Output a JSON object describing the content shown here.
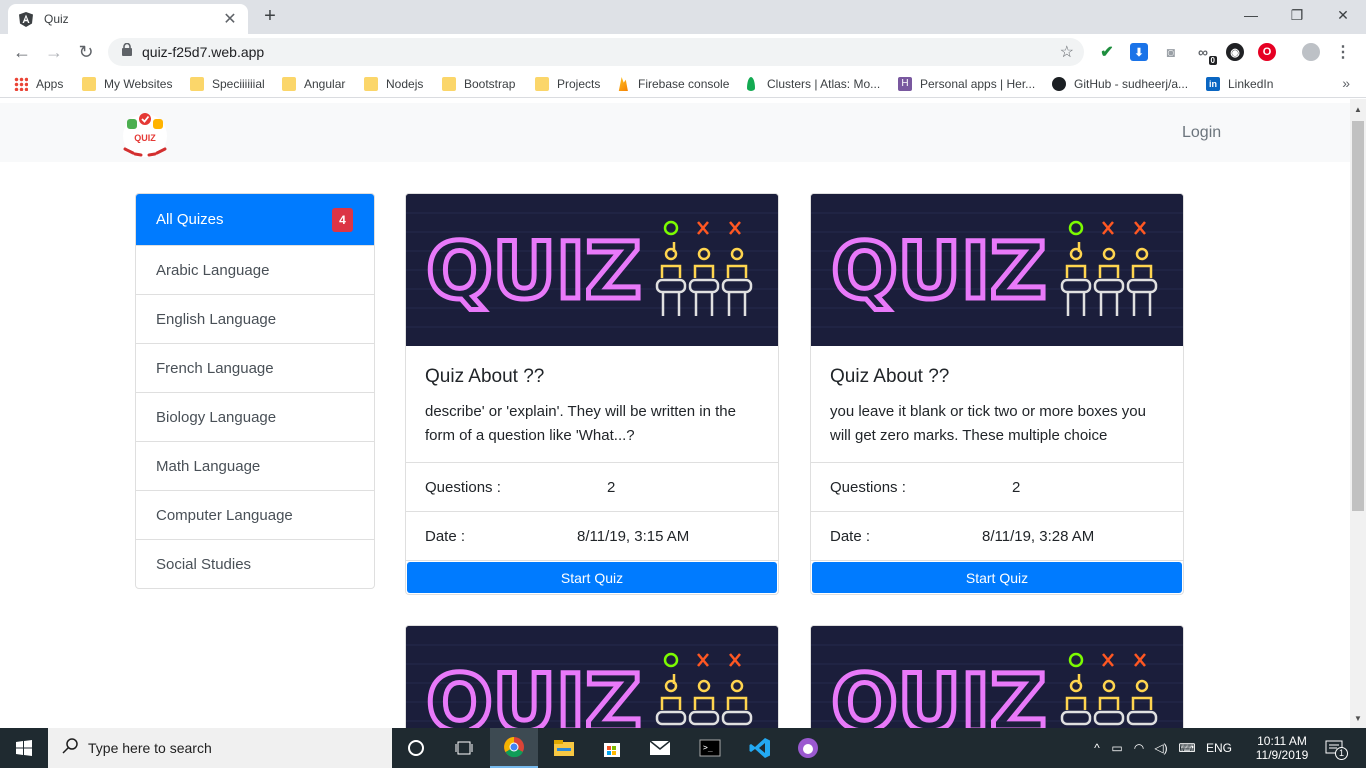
{
  "browser": {
    "tab_title": "Quiz",
    "url": "quiz-f25d7.web.app",
    "ext_badge": "0",
    "bookmarks": [
      {
        "label": "Apps",
        "icon": "apps-grid-icon"
      },
      {
        "label": "My Websites",
        "icon": "folder-icon"
      },
      {
        "label": "Speciiiiiial",
        "icon": "folder-icon"
      },
      {
        "label": "Angular",
        "icon": "folder-icon"
      },
      {
        "label": "Nodejs",
        "icon": "folder-icon"
      },
      {
        "label": "Bootstrap",
        "icon": "folder-icon"
      },
      {
        "label": "Projects",
        "icon": "folder-icon"
      },
      {
        "label": "Firebase console",
        "icon": "firebase-icon"
      },
      {
        "label": "Clusters | Atlas: Mo...",
        "icon": "mongodb-leaf-icon"
      },
      {
        "label": "Personal apps | Her...",
        "icon": "heroku-icon"
      },
      {
        "label": "GitHub - sudheerj/a...",
        "icon": "github-icon"
      },
      {
        "label": "LinkedIn",
        "icon": "linkedin-icon"
      }
    ]
  },
  "navbar": {
    "logo_text": "QUIZ",
    "login_label": "Login"
  },
  "sidebar": {
    "items": [
      {
        "label": "All Quizes",
        "badge": "4",
        "active": true
      },
      {
        "label": "Arabic Language"
      },
      {
        "label": "English Language"
      },
      {
        "label": "French Language"
      },
      {
        "label": "Biology Language"
      },
      {
        "label": "Math Language"
      },
      {
        "label": "Computer Language"
      },
      {
        "label": "Social Studies"
      }
    ]
  },
  "quiz_banner": {
    "word": "QUIZ"
  },
  "cards": [
    {
      "title": "Quiz About ??",
      "text": "describe' or 'explain'. They will be written in the form of a question like 'What...?",
      "questions_label": "Questions :",
      "questions_value": "2",
      "date_label": "Date :",
      "date_value": "8/11/19, 3:15 AM",
      "button_label": "Start Quiz"
    },
    {
      "title": "Quiz About ??",
      "text": "you leave it blank or tick two or more boxes you will get zero marks. These multiple choice",
      "questions_label": "Questions :",
      "questions_value": "2",
      "date_label": "Date :",
      "date_value": "8/11/19, 3:28 AM",
      "button_label": "Start Quiz"
    }
  ],
  "taskbar": {
    "search_placeholder": "Type here to search",
    "language": "ENG",
    "time": "10:11 AM",
    "date": "11/9/2019",
    "notification_count": "1"
  },
  "colors": {
    "primary": "#007bff",
    "badge": "#dc3545",
    "navbar_bg": "#f8f9fa",
    "taskbar_bg": "#1f2a30"
  }
}
